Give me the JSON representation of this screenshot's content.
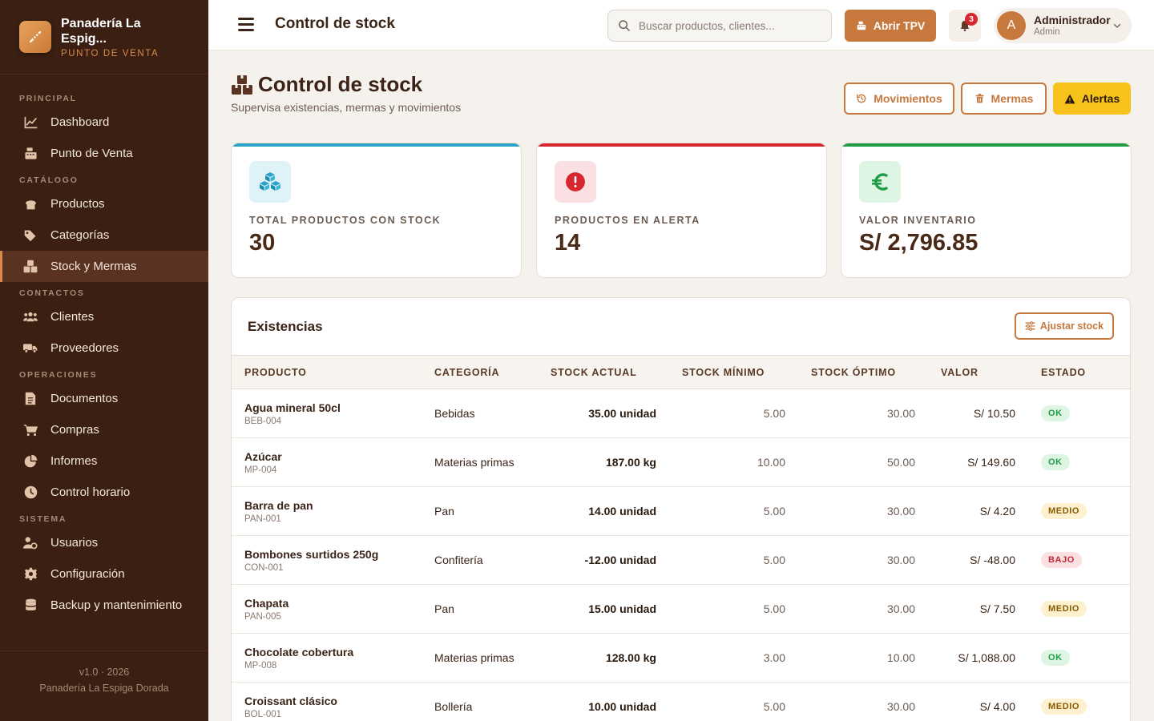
{
  "brand": {
    "name": "Panadería La Espig...",
    "subtitle": "PUNTO DE VENTA"
  },
  "sidebar": {
    "sections": [
      {
        "label": "PRINCIPAL",
        "items": [
          {
            "label": "Dashboard",
            "icon": "chart-line-icon"
          },
          {
            "label": "Punto de Venta",
            "icon": "cash-register-icon"
          }
        ]
      },
      {
        "label": "CATÁLOGO",
        "items": [
          {
            "label": "Productos",
            "icon": "bread-icon"
          },
          {
            "label": "Categorías",
            "icon": "tags-icon"
          },
          {
            "label": "Stock y Mermas",
            "icon": "boxes-icon",
            "active": true
          }
        ]
      },
      {
        "label": "CONTACTOS",
        "items": [
          {
            "label": "Clientes",
            "icon": "users-icon"
          },
          {
            "label": "Proveedores",
            "icon": "truck-icon"
          }
        ]
      },
      {
        "label": "OPERACIONES",
        "items": [
          {
            "label": "Documentos",
            "icon": "file-icon"
          },
          {
            "label": "Compras",
            "icon": "cart-icon"
          },
          {
            "label": "Informes",
            "icon": "pie-chart-icon"
          },
          {
            "label": "Control horario",
            "icon": "clock-icon"
          }
        ]
      },
      {
        "label": "SISTEMA",
        "items": [
          {
            "label": "Usuarios",
            "icon": "user-cog-icon"
          },
          {
            "label": "Configuración",
            "icon": "gear-icon"
          },
          {
            "label": "Backup y mantenimiento",
            "icon": "database-icon"
          }
        ]
      }
    ],
    "footer": {
      "version": "v1.0 · 2026",
      "company": "Panadería La Espiga Dorada"
    }
  },
  "topbar": {
    "title": "Control de stock",
    "search_placeholder": "Buscar productos, clientes...",
    "tpv_label": "Abrir TPV",
    "notifications_count": "3",
    "user": {
      "initial": "A",
      "name": "Administrador",
      "role": "Admin"
    }
  },
  "page": {
    "title": "Control de stock",
    "subtitle": "Supervisa existencias, mermas y movimientos",
    "actions": {
      "movimientos": "Movimientos",
      "mermas": "Mermas",
      "alertas": "Alertas"
    }
  },
  "stats": [
    {
      "label": "TOTAL PRODUCTOS CON STOCK",
      "value": "30",
      "color": "#2aa3c9"
    },
    {
      "label": "PRODUCTOS EN ALERTA",
      "value": "14",
      "color": "#d8262f"
    },
    {
      "label": "VALOR INVENTARIO",
      "value": "S/ 2,796.85",
      "color": "#1f9d46"
    }
  ],
  "stock_table": {
    "title": "Existencias",
    "adjust_label": "Ajustar stock",
    "columns": [
      "PRODUCTO",
      "CATEGORÍA",
      "STOCK ACTUAL",
      "STOCK MÍNIMO",
      "STOCK ÓPTIMO",
      "VALOR",
      "ESTADO"
    ],
    "rows": [
      {
        "name": "Agua mineral 50cl",
        "sku": "BEB-004",
        "category": "Bebidas",
        "stock": "35.00 unidad",
        "min": "5.00",
        "opt": "30.00",
        "value": "S/ 10.50",
        "status": "OK",
        "status_class": "ok"
      },
      {
        "name": "Azúcar",
        "sku": "MP-004",
        "category": "Materias primas",
        "stock": "187.00 kg",
        "min": "10.00",
        "opt": "50.00",
        "value": "S/ 149.60",
        "status": "OK",
        "status_class": "ok"
      },
      {
        "name": "Barra de pan",
        "sku": "PAN-001",
        "category": "Pan",
        "stock": "14.00 unidad",
        "min": "5.00",
        "opt": "30.00",
        "value": "S/ 4.20",
        "status": "MEDIO",
        "status_class": "medio"
      },
      {
        "name": "Bombones surtidos 250g",
        "sku": "CON-001",
        "category": "Confitería",
        "stock": "-12.00 unidad",
        "min": "5.00",
        "opt": "30.00",
        "value": "S/ -48.00",
        "status": "BAJO",
        "status_class": "bajo"
      },
      {
        "name": "Chapata",
        "sku": "PAN-005",
        "category": "Pan",
        "stock": "15.00 unidad",
        "min": "5.00",
        "opt": "30.00",
        "value": "S/ 7.50",
        "status": "MEDIO",
        "status_class": "medio"
      },
      {
        "name": "Chocolate cobertura",
        "sku": "MP-008",
        "category": "Materias primas",
        "stock": "128.00 kg",
        "min": "3.00",
        "opt": "10.00",
        "value": "S/ 1,088.00",
        "status": "OK",
        "status_class": "ok"
      },
      {
        "name": "Croissant clásico",
        "sku": "BOL-001",
        "category": "Bollería",
        "stock": "10.00 unidad",
        "min": "5.00",
        "opt": "30.00",
        "value": "S/ 4.00",
        "status": "MEDIO",
        "status_class": "medio"
      }
    ]
  }
}
